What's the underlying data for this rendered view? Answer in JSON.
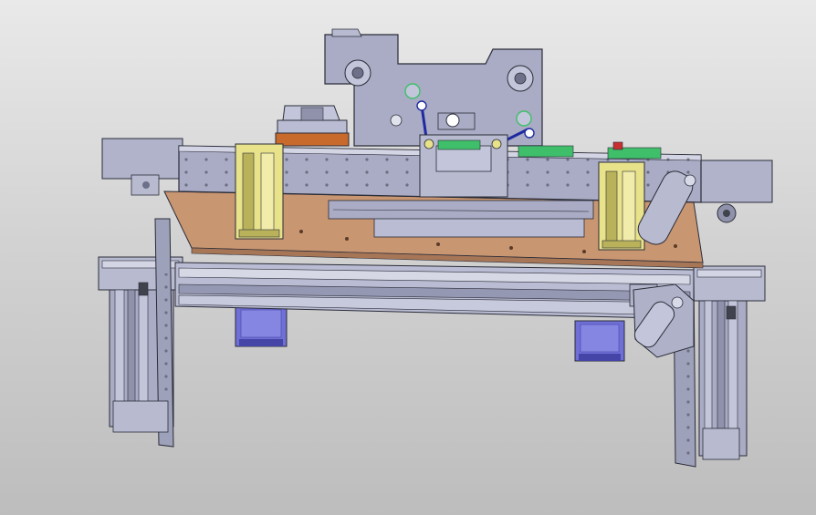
{
  "view": {
    "background_top": "#e9e9e9",
    "background_bottom": "#bdbdbd"
  },
  "palette": {
    "steel": "#a9acc4",
    "steel_light": "#c3c6da",
    "steel_dark": "#6d7088",
    "outline": "#2a2c38",
    "wood_plate": "#c99672",
    "wood_plate_dark": "#a77657",
    "bracket_yellow": "#e8e28a",
    "bracket_yellow_dark": "#b9b25a",
    "motor_blue": "#6f6fd6",
    "motor_blue_dark": "#4545a8",
    "copper": "#c86a2c",
    "rod_blue": "#1f2aa0",
    "indicator_green": "#3fbf6a",
    "indicator_red": "#c83030"
  },
  "parts": [
    {
      "name": "top-mounting-plate",
      "icon": "plate-icon"
    },
    {
      "name": "main-beam",
      "icon": "beam-icon"
    },
    {
      "name": "base-plate",
      "icon": "plate-icon"
    },
    {
      "name": "linear-rail",
      "icon": "rail-icon"
    },
    {
      "name": "left-vertical-column",
      "icon": "column-icon"
    },
    {
      "name": "right-vertical-column",
      "icon": "column-icon"
    },
    {
      "name": "stepper-motor-left",
      "icon": "motor-icon"
    },
    {
      "name": "stepper-motor-right",
      "icon": "motor-icon"
    },
    {
      "name": "guide-bracket-left",
      "icon": "bracket-icon"
    },
    {
      "name": "guide-bracket-right",
      "icon": "bracket-icon"
    },
    {
      "name": "copper-block",
      "icon": "block-icon"
    },
    {
      "name": "tension-arm",
      "icon": "arm-icon"
    }
  ]
}
